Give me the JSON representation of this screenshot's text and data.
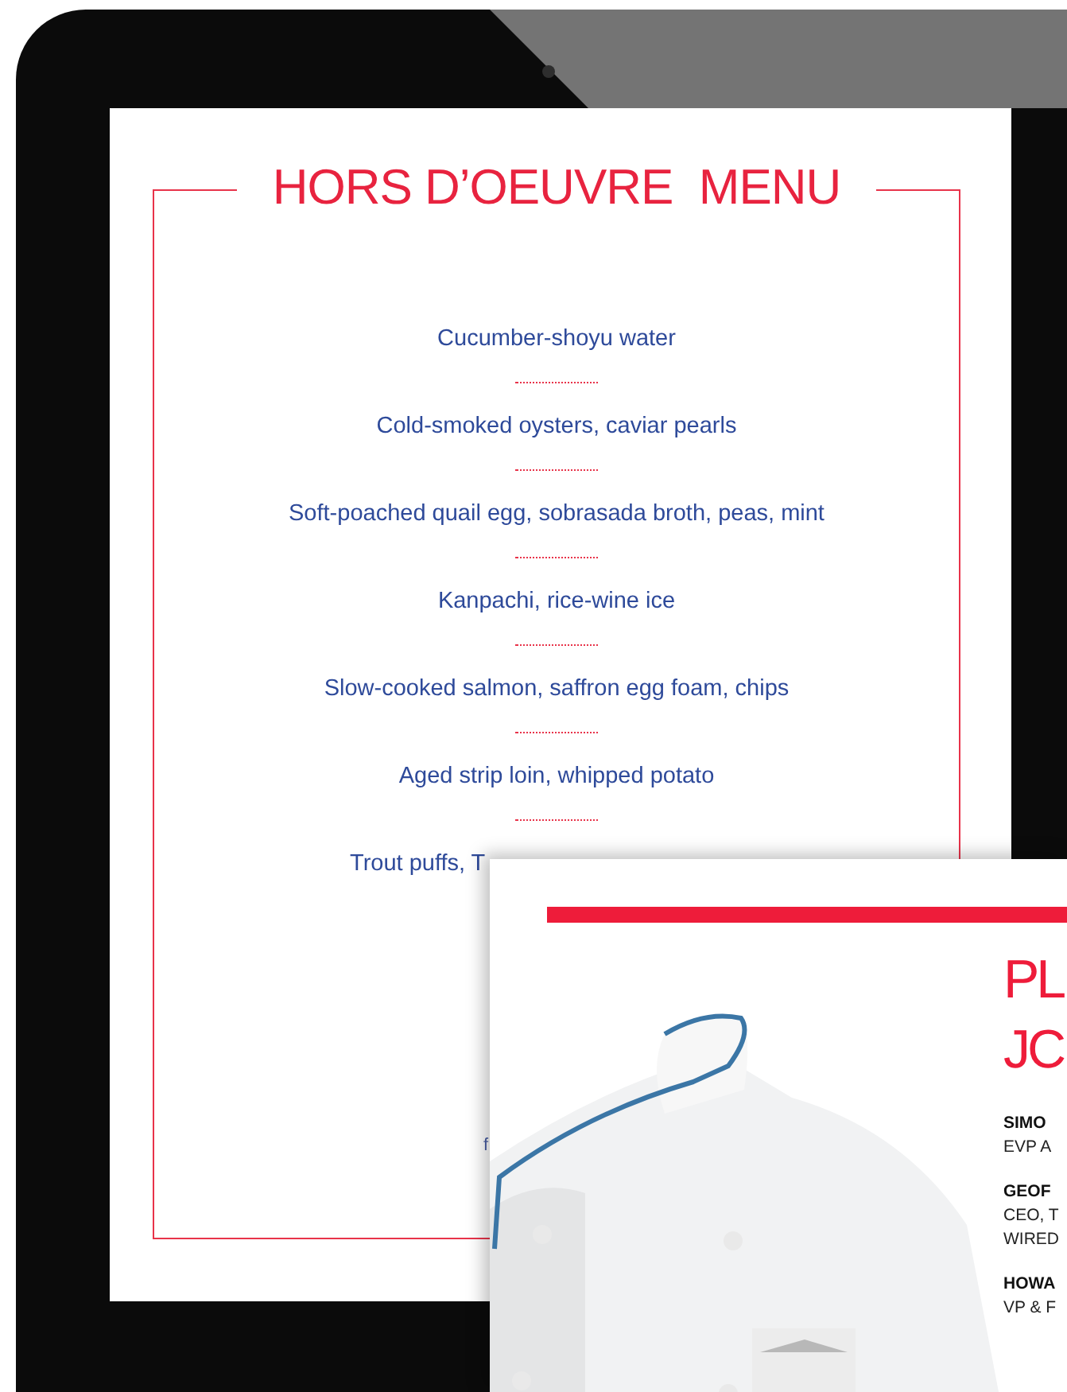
{
  "menu": {
    "title": "HORS D’OEUVRE  MENU",
    "items": [
      {
        "text": "Cucumber-shoyu water",
        "kind": "line"
      },
      {
        "text": "Cold-smoked oysters, caviar pearls",
        "kind": "line"
      },
      {
        "text": "Soft-poached quail egg, sobrasada broth, peas, mint",
        "kind": "line"
      },
      {
        "text": "Kanpachi, rice-wine ice",
        "kind": "line"
      },
      {
        "text": "Slow-cooked salmon, saffron egg foam, chips",
        "kind": "line"
      },
      {
        "text": "Aged strip loin, whipped potato",
        "kind": "line"
      },
      {
        "text": "Trout puffs, T",
        "kind": "cut"
      }
    ],
    "footer_fragment": "f"
  },
  "card": {
    "heading_lines": [
      "PL",
      "JC"
    ],
    "people": [
      {
        "name": "SIMO",
        "lines": [
          "EVP A"
        ]
      },
      {
        "name": "GEOF",
        "lines": [
          "CEO, T",
          "WIRED"
        ]
      },
      {
        "name": "HOWA",
        "lines": [
          "VP & F"
        ]
      }
    ]
  }
}
